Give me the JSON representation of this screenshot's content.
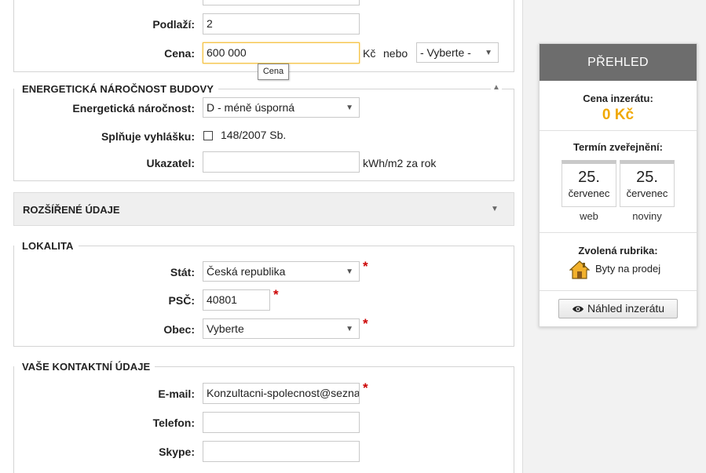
{
  "top": {
    "floor_label": "Podlaží:",
    "floor_value": "2",
    "price_label": "Cena:",
    "price_value": "600 000",
    "price_tooltip": "Cena",
    "currency": "Kč",
    "or_text": "nebo",
    "price_option": "- Vyberte -"
  },
  "energy": {
    "legend": "Energetická náročnost budovy",
    "class_label": "Energetická náročnost:",
    "class_value": "D - méně úsporná",
    "decree_label": "Splňuje vyhlášku:",
    "decree_text": "148/2007 Sb.",
    "indicator_label": "Ukazatel:",
    "indicator_value": "",
    "indicator_unit": "kWh/m2 za rok"
  },
  "extended": {
    "title": "Rozšířené údaje"
  },
  "location": {
    "legend": "Lokalita",
    "country_label": "Stát:",
    "country_value": "Česká republika",
    "zip_label": "PSČ:",
    "zip_value": "40801",
    "city_label": "Obec:",
    "city_value": "Vyberte"
  },
  "contact": {
    "legend": "Vaše kontaktní údaje",
    "email_label": "E-mail:",
    "email_value": "Konzultacni-spolecnost@seznam",
    "phone_label": "Telefon:",
    "phone_value": "",
    "skype_label": "Skype:",
    "skype_value": ""
  },
  "sidebar": {
    "header": "PŘEHLED",
    "price_title": "Cena inzerátu:",
    "price_value": "0 Kč",
    "term_title": "Termín zveřejnění:",
    "web_day": "25.",
    "web_month": "červenec",
    "web_caption": "web",
    "paper_day": "25.",
    "paper_month": "červenec",
    "paper_caption": "noviny",
    "rubric_title": "Zvolená rubrika:",
    "rubric_value": "Byty na prodej",
    "preview_button": "Náhled inzerátu"
  },
  "colors": {
    "accent_price": "#f0a800",
    "required": "#cc0000",
    "focus_border": "#f5c242"
  },
  "icons": {
    "collapse": "caret-up-icon",
    "expand": "caret-down-icon",
    "rubric": "house-icon",
    "preview": "eye-icon"
  }
}
